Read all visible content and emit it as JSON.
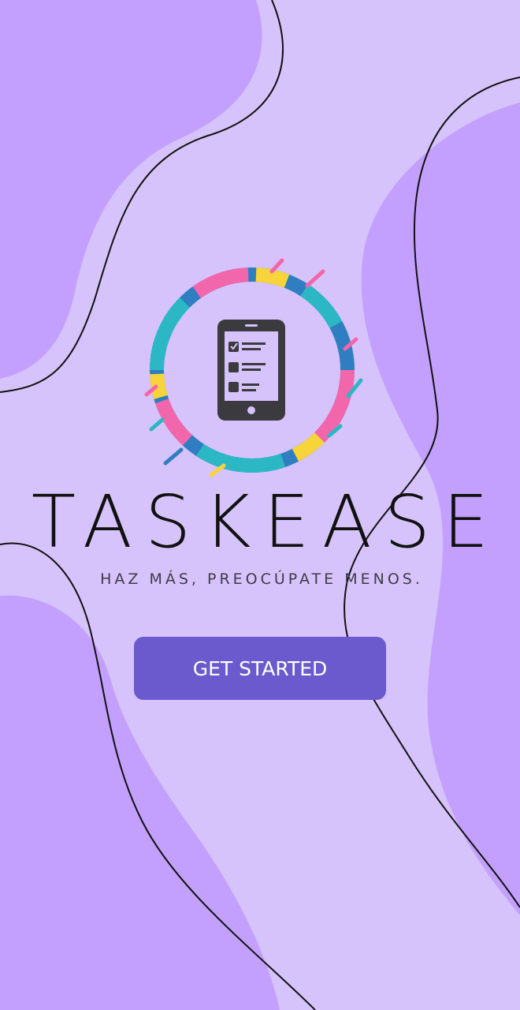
{
  "app": {
    "title": "TASKEASE",
    "tagline": "HAZ MÁS, PREOCÚPATE MENOS."
  },
  "actions": {
    "get_started_label": "GET STARTED"
  },
  "colors": {
    "background": "#d7c3fb",
    "blob": "#c3a0fd",
    "button": "#6a5acd",
    "button_text": "#ffffff",
    "ring_pink": "#f266ab",
    "ring_yellow": "#f7d43a",
    "ring_blue": "#2f7ec1",
    "ring_teal": "#2cb7c5",
    "phone": "#3a3a3f"
  },
  "icons": {
    "logo": "checklist-phone-icon"
  }
}
